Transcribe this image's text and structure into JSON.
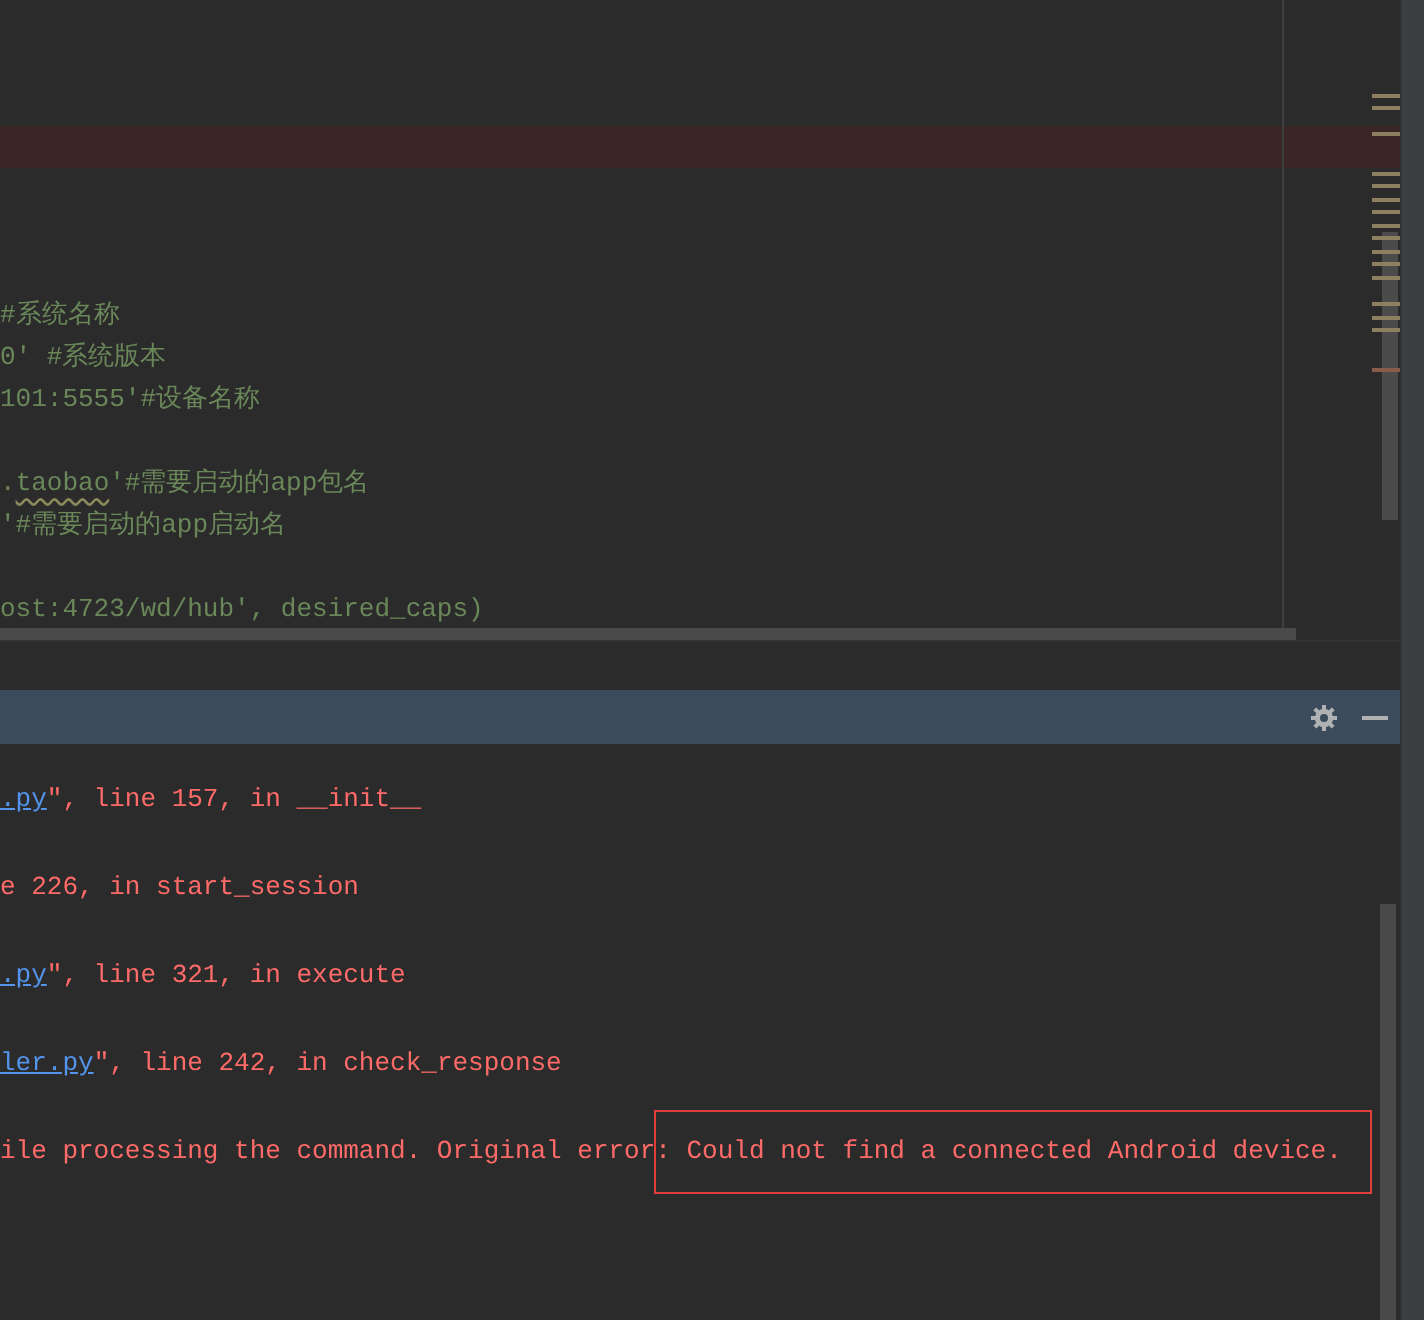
{
  "editor": {
    "lines": [
      {
        "kind": "blank"
      },
      {
        "kind": "blank"
      },
      {
        "kind": "blank"
      },
      {
        "kind": "error"
      },
      {
        "kind": "blank"
      },
      {
        "kind": "blank"
      },
      {
        "kind": "blank"
      },
      {
        "kind": "code",
        "segments": [
          {
            "text": "#系统名称",
            "kind": "plain"
          }
        ]
      },
      {
        "kind": "code",
        "segments": [
          {
            "text": "0' #系统版本",
            "kind": "plain"
          }
        ]
      },
      {
        "kind": "code",
        "segments": [
          {
            "text": "101:5555'#设备名称",
            "kind": "plain"
          }
        ]
      },
      {
        "kind": "blank"
      },
      {
        "kind": "code",
        "segments": [
          {
            "text": ".",
            "kind": "plain"
          },
          {
            "text": "taobao",
            "kind": "wavy"
          },
          {
            "text": "'#需要启动的app包名",
            "kind": "plain"
          }
        ]
      },
      {
        "kind": "code",
        "segments": [
          {
            "text": "'#需要启动的app启动名",
            "kind": "plain"
          }
        ]
      },
      {
        "kind": "blank"
      },
      {
        "kind": "code",
        "segments": [
          {
            "text": "ost:4723/wd/hub', desired_caps)",
            "kind": "plain"
          }
        ]
      }
    ]
  },
  "console": {
    "lines": [
      {
        "kind": "text",
        "segments": [
          {
            "text": ".py",
            "kind": "link"
          },
          {
            "text": "\", line 157, in __init__",
            "kind": "plain"
          }
        ]
      },
      {
        "kind": "blank"
      },
      {
        "kind": "text",
        "segments": [
          {
            "text": "e 226, in start_session",
            "kind": "plain"
          }
        ]
      },
      {
        "kind": "blank"
      },
      {
        "kind": "text",
        "segments": [
          {
            "text": ".py",
            "kind": "link"
          },
          {
            "text": "\", line 321, in execute",
            "kind": "plain"
          }
        ]
      },
      {
        "kind": "blank"
      },
      {
        "kind": "text",
        "segments": [
          {
            "text": "ler.py",
            "kind": "link"
          },
          {
            "text": "\", line 242, in check_response",
            "kind": "plain"
          }
        ]
      },
      {
        "kind": "blank"
      },
      {
        "kind": "text",
        "annotated": true,
        "segments": [
          {
            "text": "ile processing the command. Original error: Could not find a connected Android device.",
            "kind": "plain"
          }
        ]
      }
    ]
  }
}
